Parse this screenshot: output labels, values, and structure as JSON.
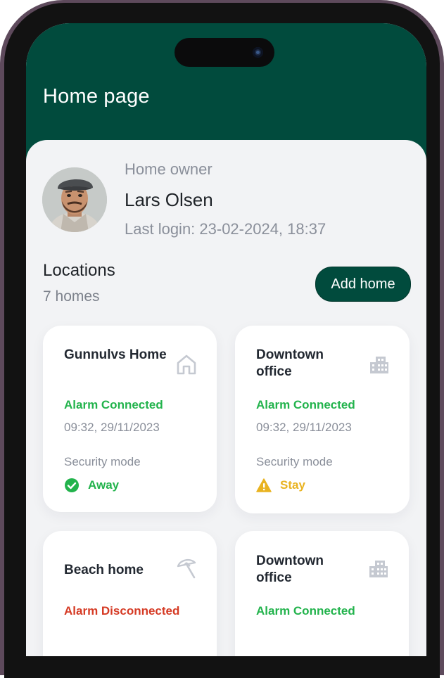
{
  "header": {
    "title": "Home page"
  },
  "owner": {
    "role": "Home owner",
    "name": "Lars Olsen",
    "last_login": "Last login: 23-02-2024, 18:37"
  },
  "locations": {
    "title": "Locations",
    "count": "7 homes",
    "add_button": "Add home"
  },
  "colors": {
    "brand": "#014b3d",
    "connected": "#22b34c",
    "disconnected": "#d53a24",
    "stay": "#e9b320"
  },
  "cards": [
    {
      "name": "Gunnulvs Home",
      "icon": "house-icon",
      "status": "Alarm Connected",
      "timestamp": "09:32, 29/11/2023",
      "mode_label": "Security mode",
      "mode": "Away",
      "mode_icon": "check-circle-icon"
    },
    {
      "name": "Downtown office",
      "icon": "building-icon",
      "status": "Alarm Connected",
      "timestamp": "09:32, 29/11/2023",
      "mode_label": "Security mode",
      "mode": "Stay",
      "mode_icon": "warning-triangle-icon"
    },
    {
      "name": "Beach home",
      "icon": "beach-umbrella-icon",
      "status": "Alarm Disconnected"
    },
    {
      "name": "Downtown office",
      "icon": "building-icon",
      "status": "Alarm Connected"
    }
  ]
}
